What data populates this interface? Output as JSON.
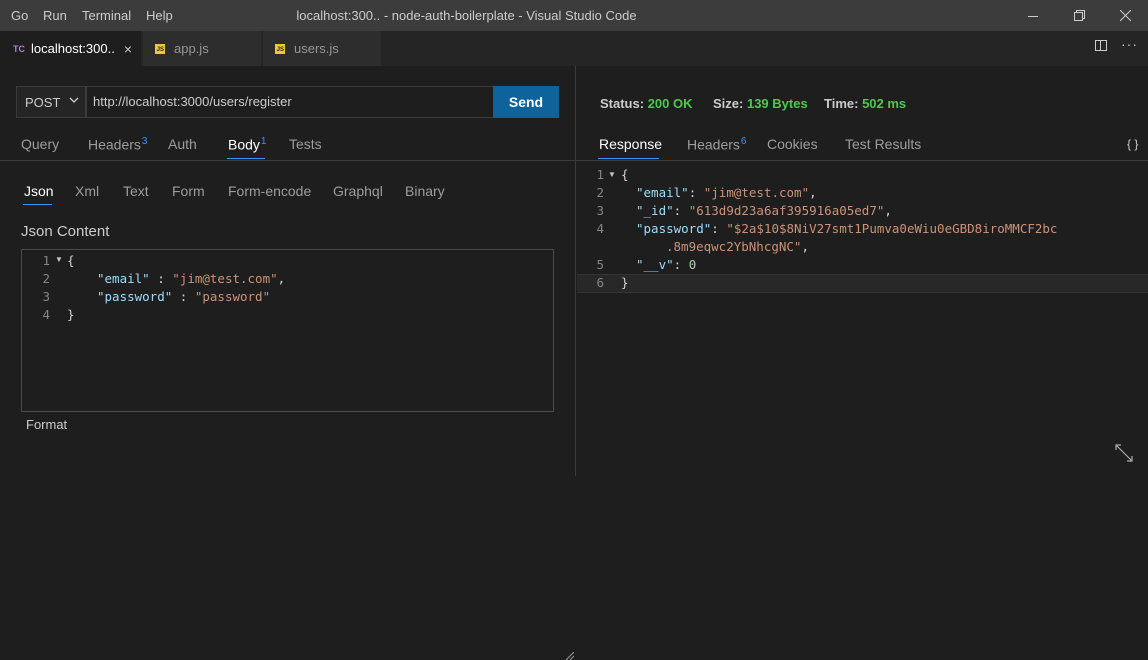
{
  "menu": [
    "Go",
    "Run",
    "Terminal",
    "Help"
  ],
  "window_title": "localhost:300.. - node-auth-boilerplate - Visual Studio Code",
  "tabs": [
    {
      "icon_text": "TC",
      "label": "localhost:300..",
      "close": "×"
    },
    {
      "icon_text": "JS",
      "label": "app.js"
    },
    {
      "icon_text": "JS",
      "label": "users.js"
    }
  ],
  "toolbar": {
    "more": "···"
  },
  "request": {
    "method": "POST",
    "url": "http://localhost:3000/users/register",
    "send_label": "Send",
    "tabs": [
      {
        "label": "Query",
        "badge": ""
      },
      {
        "label": "Headers",
        "badge": "3"
      },
      {
        "label": "Auth",
        "badge": ""
      },
      {
        "label": "Body",
        "badge": "1"
      },
      {
        "label": "Tests",
        "badge": ""
      }
    ],
    "active_tab": "Body",
    "body_tabs": [
      "Json",
      "Xml",
      "Text",
      "Form",
      "Form-encode",
      "Graphql",
      "Binary"
    ],
    "active_body_tab": "Json",
    "json_label": "Json Content",
    "json_lines": [
      {
        "n": "1",
        "text": "{"
      },
      {
        "n": "2",
        "key": "\"email\"",
        "sep": " : ",
        "value": "\"jim@test.com\"",
        "tail": ","
      },
      {
        "n": "3",
        "key": "\"password\"",
        "sep": " : ",
        "value": "\"password\"",
        "tail": ""
      },
      {
        "n": "4",
        "text": "}"
      }
    ],
    "format_label": "Format"
  },
  "response": {
    "status_label": "Status:",
    "status_value": "200 OK",
    "size_label": "Size:",
    "size_value": "139 Bytes",
    "time_label": "Time:",
    "time_value": "502 ms",
    "tabs": [
      {
        "label": "Response",
        "badge": ""
      },
      {
        "label": "Headers",
        "badge": "6"
      },
      {
        "label": "Cookies",
        "badge": ""
      },
      {
        "label": "Test Results",
        "badge": ""
      }
    ],
    "active_tab": "Response",
    "braces_button": "{ }",
    "lines": [
      {
        "n": "1",
        "text": "{"
      },
      {
        "n": "2",
        "key": "\"email\"",
        "value": "\"jim@test.com\"",
        "tail": ","
      },
      {
        "n": "3",
        "key": "\"_id\"",
        "value": "\"613d9d23a6af395916a05ed7\"",
        "tail": ","
      },
      {
        "n": "4",
        "key": "\"password\"",
        "value": "\"$2a$10$8NiV27smt1Pumva0eWiu0eGBD8iroMMCF2bc",
        "wrap": ".8m9eqwc2YbNhcgNC\"",
        "tail": ","
      },
      {
        "n": "5",
        "key": "\"__v\"",
        "number": "0",
        "tail": ""
      },
      {
        "n": "6",
        "text": "}"
      }
    ]
  },
  "colors": {
    "accent": "#3794ff",
    "send": "#0e639c",
    "ok": "#4ec94e",
    "string": "#ce9178",
    "key": "#9cdcfe",
    "number": "#b5cea8"
  }
}
